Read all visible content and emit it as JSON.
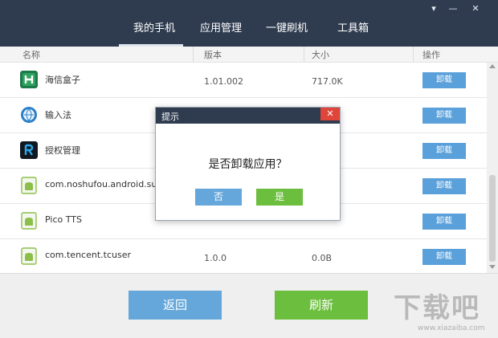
{
  "nav": {
    "items": [
      {
        "label": "我的手机"
      },
      {
        "label": "应用管理"
      },
      {
        "label": "一键刷机"
      },
      {
        "label": "工具箱"
      }
    ],
    "active": "我的手机"
  },
  "window_controls": {
    "menu": "▾",
    "minimize": "—",
    "close": "✕"
  },
  "table": {
    "headers": [
      "名称",
      "版本",
      "大小",
      "操作"
    ],
    "rows": [
      {
        "name": "海信盒子",
        "version": "1.01.002",
        "size": "717.0K",
        "action": "卸载",
        "icon": "h-app-icon"
      },
      {
        "name": "输入法",
        "version": "",
        "size": "",
        "action": "卸载",
        "icon": "keyboard-globe-icon"
      },
      {
        "name": "授权管理",
        "version": "",
        "size": "",
        "action": "卸载",
        "icon": "r-app-icon"
      },
      {
        "name": "com.noshufou.android.su",
        "version": "",
        "size": "",
        "action": "卸载",
        "icon": "android-generic-icon"
      },
      {
        "name": "Pico TTS",
        "version": "",
        "size": "",
        "action": "卸载",
        "icon": "android-generic-icon"
      },
      {
        "name": "com.tencent.tcuser",
        "version": "1.0.0",
        "size": "0.0B",
        "action": "卸载",
        "icon": "android-generic-icon"
      }
    ]
  },
  "footer": {
    "back": "返回",
    "refresh": "刷新"
  },
  "watermark": {
    "text": "下载吧",
    "url": "www.xiazaiba.com"
  },
  "dialog": {
    "title": "提示",
    "close": "✕",
    "message": "是否卸载应用？",
    "no": "否",
    "yes": "是"
  },
  "colors": {
    "topbar": "#2f3c50",
    "blue_button": "#65a7da",
    "green_button": "#6cbe3e",
    "close_red": "#e0453a"
  }
}
